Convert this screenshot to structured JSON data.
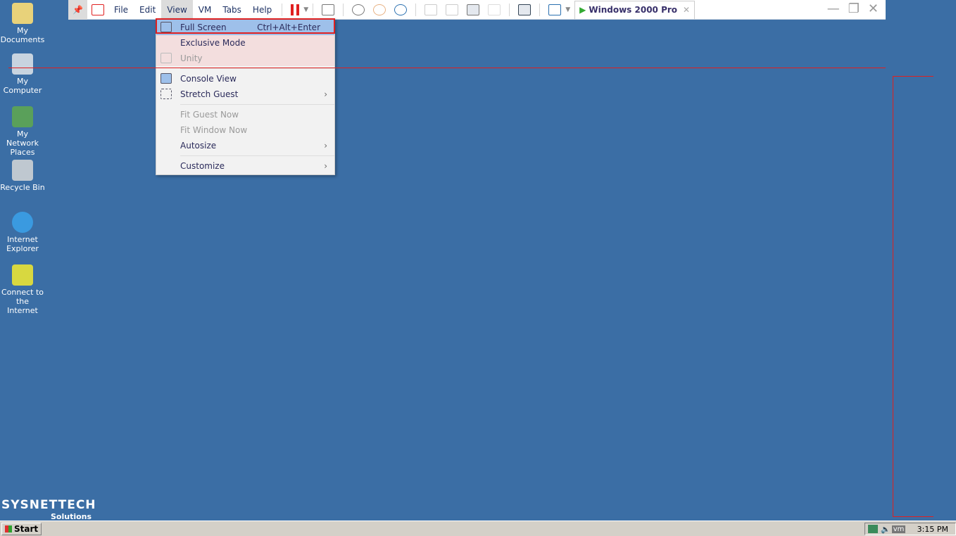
{
  "desktop": {
    "icons": [
      {
        "label": "My Documents"
      },
      {
        "label": "My Computer"
      },
      {
        "label": "My Network Places"
      },
      {
        "label": "Recycle Bin"
      },
      {
        "label": "Internet Explorer"
      },
      {
        "label": "Connect to the Internet"
      }
    ]
  },
  "toolbar": {
    "menus": [
      "File",
      "Edit",
      "View",
      "VM",
      "Tabs",
      "Help"
    ],
    "active_menu": "View",
    "tab_title": "Windows 2000 Pro",
    "pause_color": "#e02020"
  },
  "view_menu": {
    "items": [
      {
        "label": "Full Screen",
        "shortcut": "Ctrl+Alt+Enter",
        "highlighted": true
      },
      {
        "label": "Exclusive Mode"
      },
      {
        "label": "Unity",
        "disabled": true
      },
      {
        "label": "Console View"
      },
      {
        "label": "Stretch Guest",
        "submenu": true
      },
      {
        "label": "Fit Guest Now",
        "disabled": true
      },
      {
        "label": "Fit Window Now",
        "disabled": true
      },
      {
        "label": "Autosize",
        "submenu": true
      },
      {
        "label": "Customize",
        "submenu": true
      }
    ]
  },
  "watermark": {
    "brand": "SYSNETTECH",
    "sub": "Solutions"
  },
  "taskbar": {
    "start": "Start",
    "clock": "3:15 PM",
    "tray_vm": "vm"
  },
  "colors": {
    "desktop": "#3b6ea5",
    "highlight": "#9ec0ea",
    "annotation": "#e02020"
  }
}
